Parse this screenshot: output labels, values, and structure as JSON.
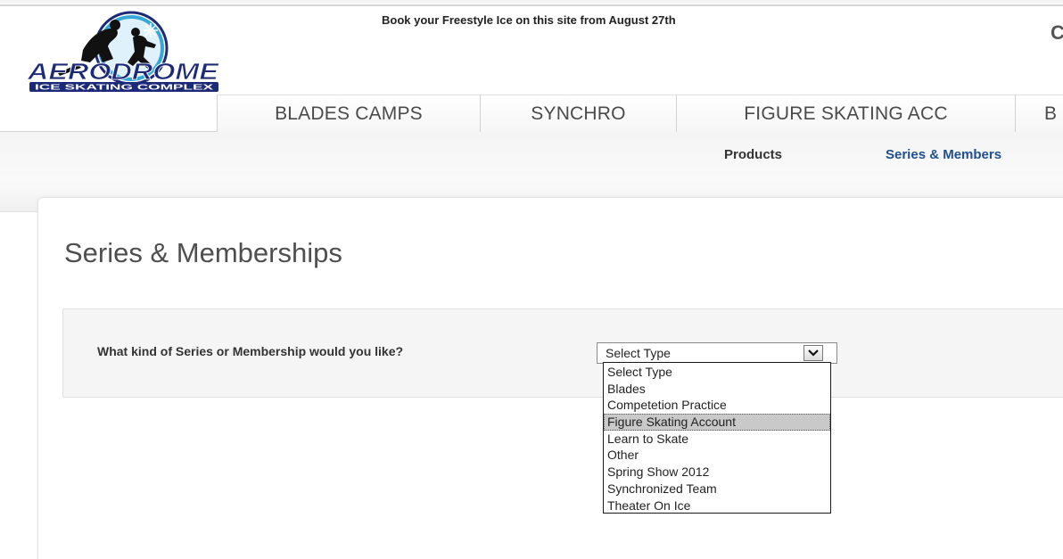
{
  "header": {
    "logo": {
      "name": "AERODROME",
      "tagline": "ICE SKATING COMPLEX",
      "icon": "skaters-logo-icon"
    },
    "announcement": "Book your Freestyle Ice on this site from August 27th",
    "corner_partial_text": "C"
  },
  "main_nav": {
    "tabs": [
      {
        "label": "BLADES CAMPS"
      },
      {
        "label": "SYNCHRO"
      },
      {
        "label": "FIGURE SKATING ACC"
      },
      {
        "label": "B"
      }
    ]
  },
  "sub_nav": {
    "items": [
      {
        "label": "Products"
      },
      {
        "label": "Series & Members"
      }
    ],
    "active_color": "#1f4f8f"
  },
  "main": {
    "title": "Series & Memberships",
    "filter": {
      "label": "What kind of Series or Membership would you like?",
      "select": {
        "selected_value": "Select Type",
        "arrow_icon": "chevron-down-icon",
        "expanded": true,
        "highlighted_option": "Figure Skating Account",
        "options": [
          "Select Type",
          "Blades",
          "Competetion Practice",
          "Figure Skating Account",
          "Learn to Skate",
          "Other",
          "Spring Show 2012",
          "Synchronized Team",
          "Theater On Ice"
        ]
      }
    }
  },
  "colors": {
    "logo_navy": "#1c2a78",
    "logo_ring": "#37a8d6",
    "logo_red": "#c8102e",
    "highlight_gray": "#c9c9c9"
  }
}
